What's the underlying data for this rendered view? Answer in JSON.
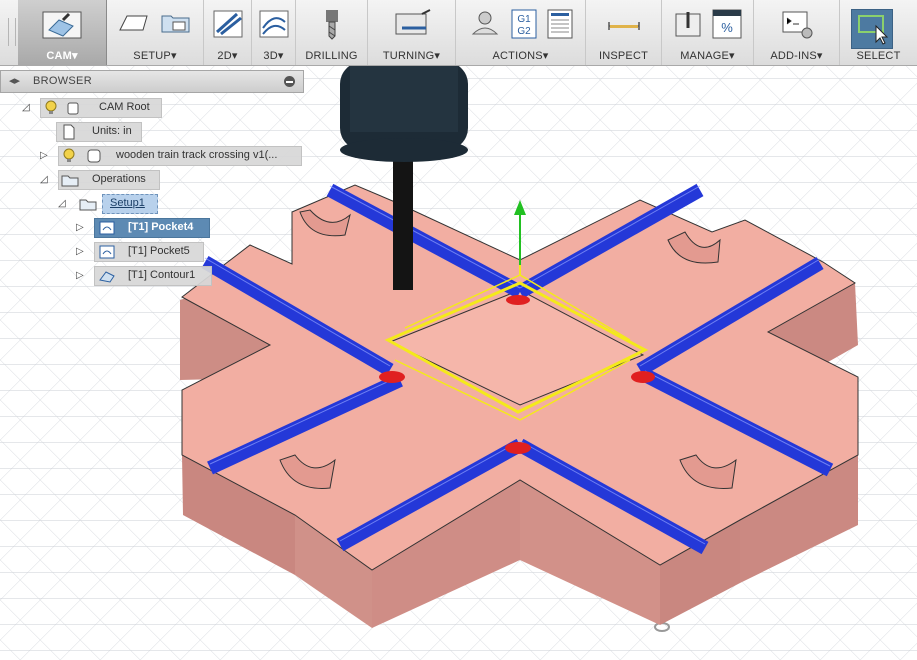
{
  "toolbar": {
    "groups": [
      {
        "label": "CAM▾",
        "icon": "cam-workspace-icon"
      },
      {
        "label": "SETUP▾",
        "icon": "setup-icon"
      },
      {
        "label": "2D▾",
        "icon": "2d-toolpath-icon"
      },
      {
        "label": "3D▾",
        "icon": "3d-toolpath-icon"
      },
      {
        "label": "DRILLING",
        "icon": "drill-icon"
      },
      {
        "label": "TURNING▾",
        "icon": "turning-icon"
      },
      {
        "label": "ACTIONS▾",
        "icon": "gcode-icon"
      },
      {
        "label": "INSPECT",
        "icon": "measure-icon"
      },
      {
        "label": "MANAGE▾",
        "icon": "tool-library-icon"
      },
      {
        "label": "ADD-INS▾",
        "icon": "scripts-icon"
      },
      {
        "label": "SELECT",
        "icon": "select-arrow-icon"
      }
    ],
    "actions_icon_text": [
      "G1",
      "G2"
    ],
    "manage_icon_text": "%"
  },
  "browser": {
    "title": "BROWSER",
    "tree": [
      {
        "label": "CAM Root"
      },
      {
        "label": "Units: in"
      },
      {
        "label": "wooden train track crossing v1(..."
      },
      {
        "label": "Operations"
      },
      {
        "label": "Setup1"
      },
      {
        "label": "[T1] Pocket4"
      },
      {
        "label": "[T1] Pocket5"
      },
      {
        "label": "[T1] Contour1"
      }
    ]
  },
  "colors": {
    "viewport_background": "#ffffff",
    "grid": "#c9ccd2",
    "part_top": "#f0ada2",
    "part_side": "#d6928a",
    "toolpath_pocket": "#2438d8",
    "toolpath_contour": "#f4ea1a",
    "tool_holder": "#1c2a36",
    "selection_highlight": "#5d8ab3",
    "active_setup": "#b8d1ec"
  }
}
